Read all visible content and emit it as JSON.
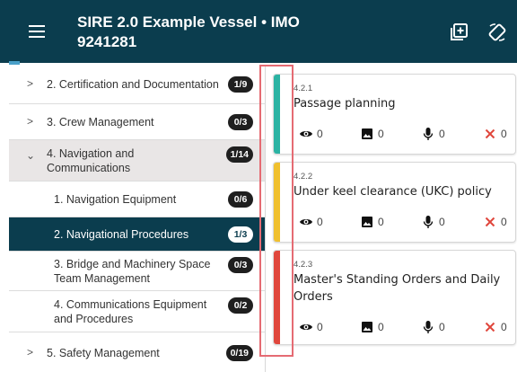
{
  "header": {
    "title": "SIRE 2.0 Example Vessel • IMO 9241281",
    "menu_icon": "menu-icon",
    "add_icon": "add-square-icon",
    "rotate_icon": "rotate-icon",
    "color": "#0b3d4e"
  },
  "sidebar": {
    "items": [
      {
        "label": "2. Certification and Documentation",
        "badge": "1/9",
        "state": "collapsed",
        "icon": "chevron-right-icon"
      },
      {
        "label": "3. Crew Management",
        "badge": "0/3",
        "state": "collapsed",
        "icon": "chevron-right-icon"
      },
      {
        "label": "4. Navigation and Communications",
        "badge": "1/14",
        "state": "expanded",
        "icon": "chevron-down-icon"
      },
      {
        "label": "1. Navigation Equipment",
        "badge": "0/6",
        "state": "sub"
      },
      {
        "label": "2. Navigational Procedures",
        "badge": "1/3",
        "state": "active"
      },
      {
        "label": "3. Bridge and Machinery Space Team Management",
        "badge": "0/3",
        "state": "sub"
      },
      {
        "label": "4. Communications Equipment and Procedures",
        "badge": "0/2",
        "state": "sub"
      },
      {
        "label": "5. Safety Management",
        "badge": "0/19",
        "state": "collapsed",
        "icon": "chevron-right-icon"
      }
    ]
  },
  "questions": [
    {
      "code": "4.2.1",
      "title": "Passage planning",
      "color": "#2bb3a3",
      "views": "0",
      "photos": "0",
      "audio": "0",
      "issues": "0"
    },
    {
      "code": "4.2.2",
      "title": "Under keel clearance (UKC) policy",
      "color": "#f0c02e",
      "views": "0",
      "photos": "0",
      "audio": "0",
      "issues": "0"
    },
    {
      "code": "4.2.3",
      "title": "Master's Standing Orders and Daily Orders",
      "color": "#e0463c",
      "views": "0",
      "photos": "0",
      "audio": "0",
      "issues": "0"
    }
  ],
  "colors": {
    "accent": "#4aa0c9",
    "highlight": "#e56b73",
    "issue": "#e0463c"
  }
}
